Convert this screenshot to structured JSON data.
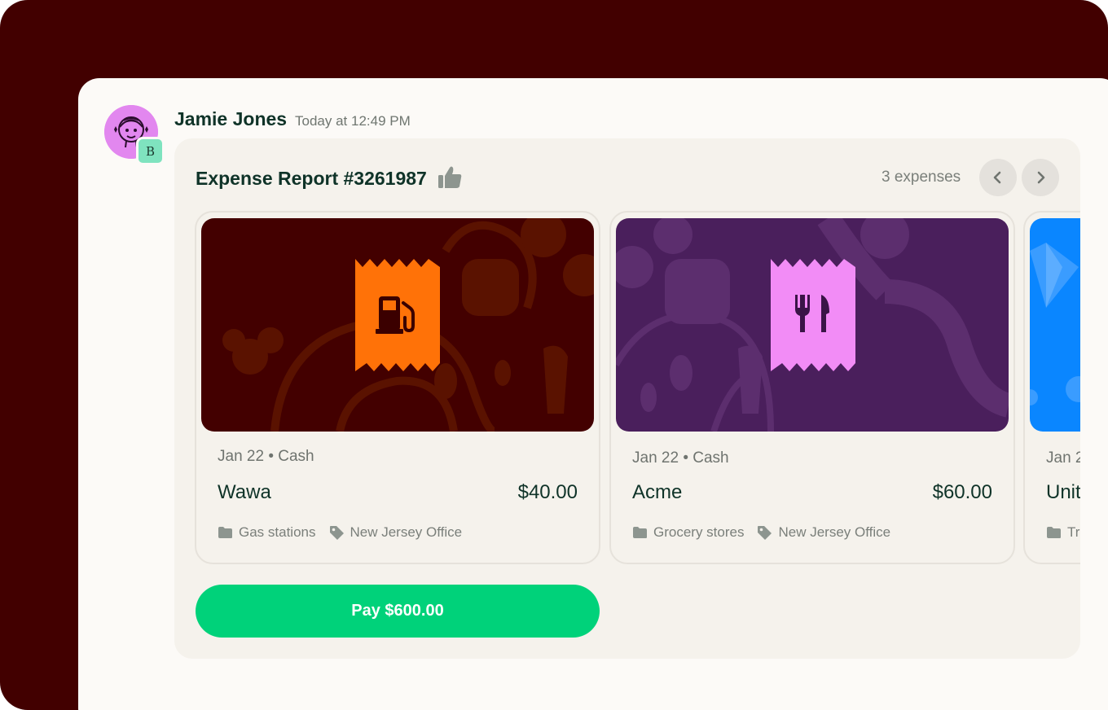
{
  "message": {
    "author": "Jamie Jones",
    "timestamp": "Today at 12:49 PM",
    "workspace_badge": "B"
  },
  "report": {
    "title": "Expense Report #3261987",
    "expense_count": "3 expenses",
    "pay_label": "Pay $600.00"
  },
  "expenses": [
    {
      "meta": "Jan 22 • Cash",
      "merchant": "Wawa",
      "amount": "$40.00",
      "category": "Gas stations",
      "tag": "New Jersey Office",
      "icon": "fuel-pump-icon",
      "colors": {
        "background": "#430000",
        "pattern": "#5a1200",
        "receipt": "#ff7208",
        "glyph": "#3b0000"
      }
    },
    {
      "meta": "Jan 22 • Cash",
      "merchant": "Acme",
      "amount": "$60.00",
      "category": "Grocery stores",
      "tag": "New Jersey Office",
      "icon": "fork-knife-icon",
      "colors": {
        "background": "#4a1f5c",
        "pattern": "#5c2e6e",
        "receipt": "#f28cf6",
        "glyph": "#3a1447"
      }
    },
    {
      "meta": "Jan 2",
      "merchant": "Unit",
      "amount": "",
      "category": "Tr",
      "tag": "",
      "icon": "plane-icon",
      "colors": {
        "background": "#0a86ff",
        "pattern": "#3a9cff",
        "receipt": "",
        "glyph": ""
      }
    }
  ],
  "colors": {
    "frame": "#420000",
    "panel": "#fcfaf7",
    "card": "#f5f2ec",
    "pay_button": "#00d27a",
    "text_dark": "#0f3328"
  }
}
